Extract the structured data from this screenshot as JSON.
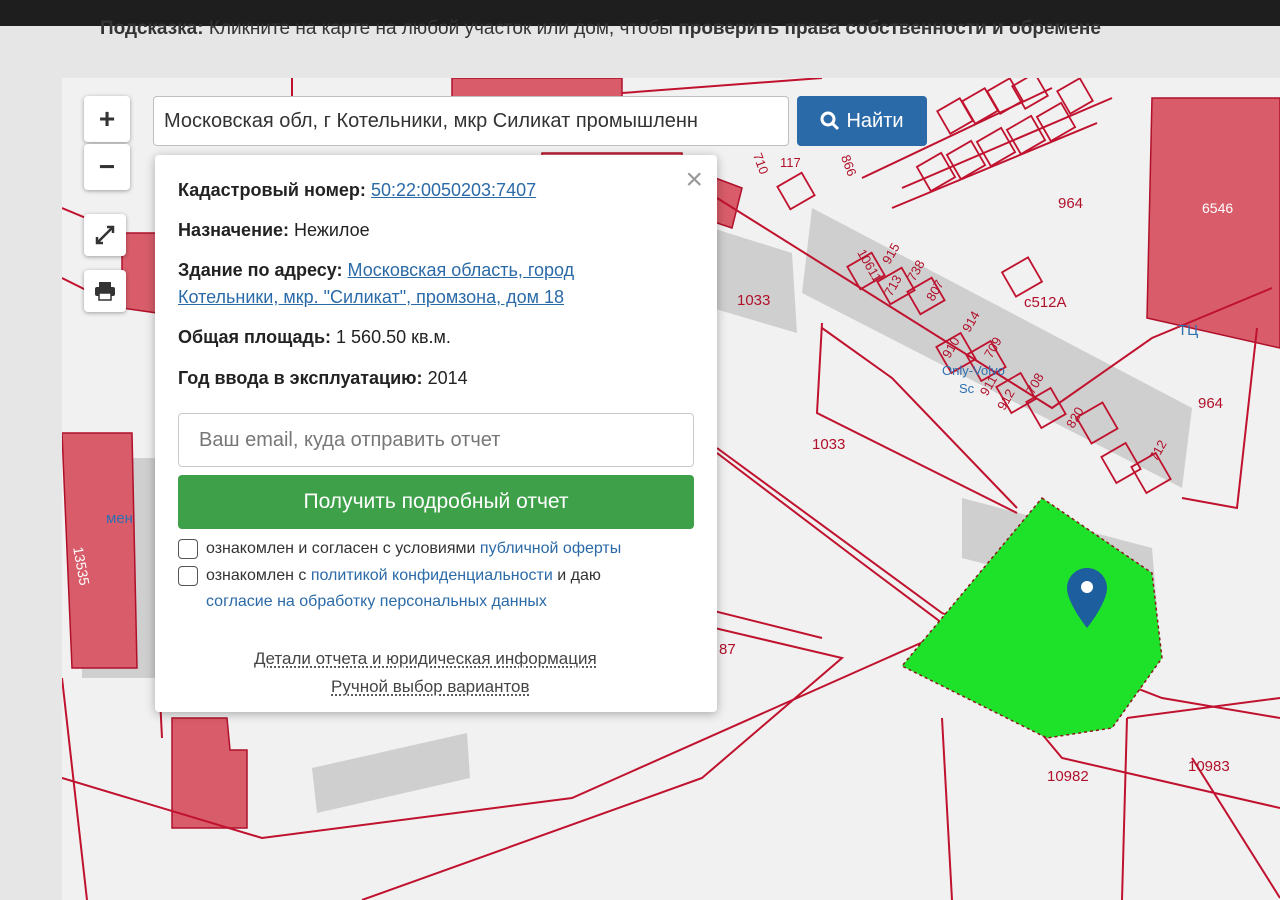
{
  "hint": {
    "label": "Подсказка:",
    "text": " Кликните на карте на любой участок или дом, чтобы ",
    "bold_tail": "проверить права собственности и обремене"
  },
  "controls": {
    "zoom_in": "+",
    "zoom_out": "−"
  },
  "search": {
    "value": "Московская обл, г Котельники, мкр Силикат промышленн",
    "button_label": "Найти"
  },
  "popup": {
    "close": "×",
    "cadastral_label": "Кадастровый номер:",
    "cadastral_value": "50:22:0050203:7407",
    "purpose_label": "Назначение:",
    "purpose_value": "Нежилое",
    "building_label": "Здание по адресу:",
    "building_value_line1": "Московская область, город",
    "building_value_line2": "Котельники, мкр. \"Силикат\", промзона, дом 18",
    "area_label": "Общая площадь:",
    "area_value": "1 560.50 кв.м.",
    "year_label": "Год ввода в эксплуатацию:",
    "year_value": "2014",
    "email_placeholder": "Ваш email, куда отправить отчет",
    "report_button": "Получить подробный отчет",
    "consent1_text": "ознакомлен и согласен с условиями ",
    "consent1_link": "публичной оферты",
    "consent2_text": "ознакомлен с ",
    "consent2_link": "политикой конфиденциальности",
    "consent2_tail": " и даю",
    "consent2_link2": "согласие на обработку персональных данных",
    "details_link": "Детали отчета и юридическая информация",
    "manual_link": "Ручной выбор вариантов"
  },
  "map_labels": {
    "l964a": "964",
    "l6546": "6546",
    "l1033a": "1033",
    "l512": "с512А",
    "l1033b": "1033",
    "l964b": "964",
    "l10982": "10982",
    "l10983": "10983",
    "l87": "87",
    "l13535": "13535",
    "l710": "710",
    "l117": "117",
    "l866": "866",
    "l915": "915",
    "l10611": "10611",
    "l713": "713",
    "l738": "738",
    "l807": "807",
    "l910": "910",
    "l914": "914",
    "l709": "709",
    "l911": "911",
    "l912": "912",
    "l708": "708",
    "l820": "820",
    "l712": "712",
    "tc": "ТЦ",
    "only": "Only-Volvo",
    "sc": "Sc",
    "men": "мен"
  }
}
